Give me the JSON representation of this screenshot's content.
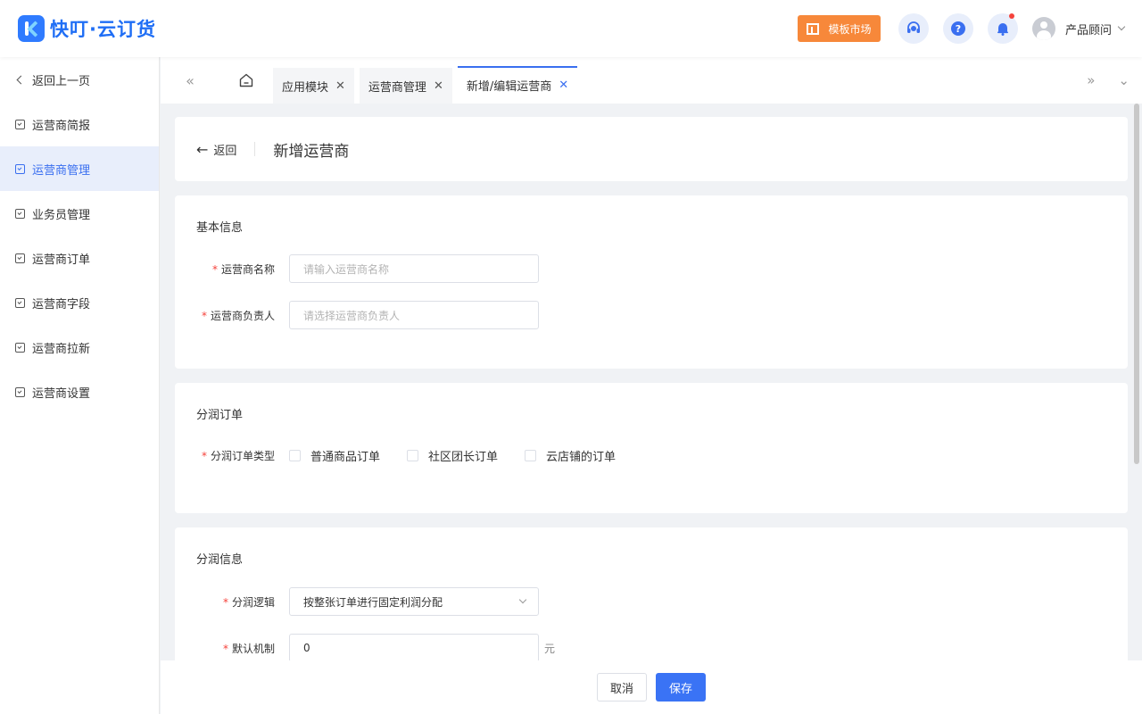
{
  "header": {
    "app_name": "快叮·云订货",
    "market_label": "模板市场",
    "user_name": "产品顾问",
    "notification_dot_color": "#f5423b"
  },
  "sidebar": {
    "back_label": "返回上一页",
    "items": [
      {
        "label": "运营商简报",
        "active": false
      },
      {
        "label": "运营商管理",
        "active": true
      },
      {
        "label": "业务员管理",
        "active": false
      },
      {
        "label": "运营商订单",
        "active": false
      },
      {
        "label": "运营商字段",
        "active": false
      },
      {
        "label": "运营商拉新",
        "active": false
      },
      {
        "label": "运营商设置",
        "active": false
      }
    ]
  },
  "tabs": [
    {
      "label": "应用模块",
      "active": false
    },
    {
      "label": "运营商管理",
      "active": false
    },
    {
      "label": "新增/编辑运营商",
      "active": true
    }
  ],
  "page": {
    "back_label": "返回",
    "title": "新增运营商"
  },
  "basic_info": {
    "title": "基本信息",
    "name_label": "运营商名称",
    "name_placeholder": "请输入运营商名称",
    "owner_label": "运营商负责人",
    "owner_placeholder": "请选择运营商负责人"
  },
  "profit_order": {
    "title": "分润订单",
    "type_label": "分润订单类型",
    "options": [
      "普通商品订单",
      "社区团长订单",
      "云店铺的订单"
    ]
  },
  "profit_info": {
    "title": "分润信息",
    "logic_label": "分润逻辑",
    "logic_value": "按整张订单进行固定利润分配",
    "default_label": "默认机制",
    "default_value": "0",
    "default_unit": "元"
  },
  "footer": {
    "cancel_label": "取消",
    "save_label": "保存"
  },
  "colors": {
    "accent": "#3a6ff0",
    "market": "#f7883a",
    "brand": "#1f6ef5"
  }
}
